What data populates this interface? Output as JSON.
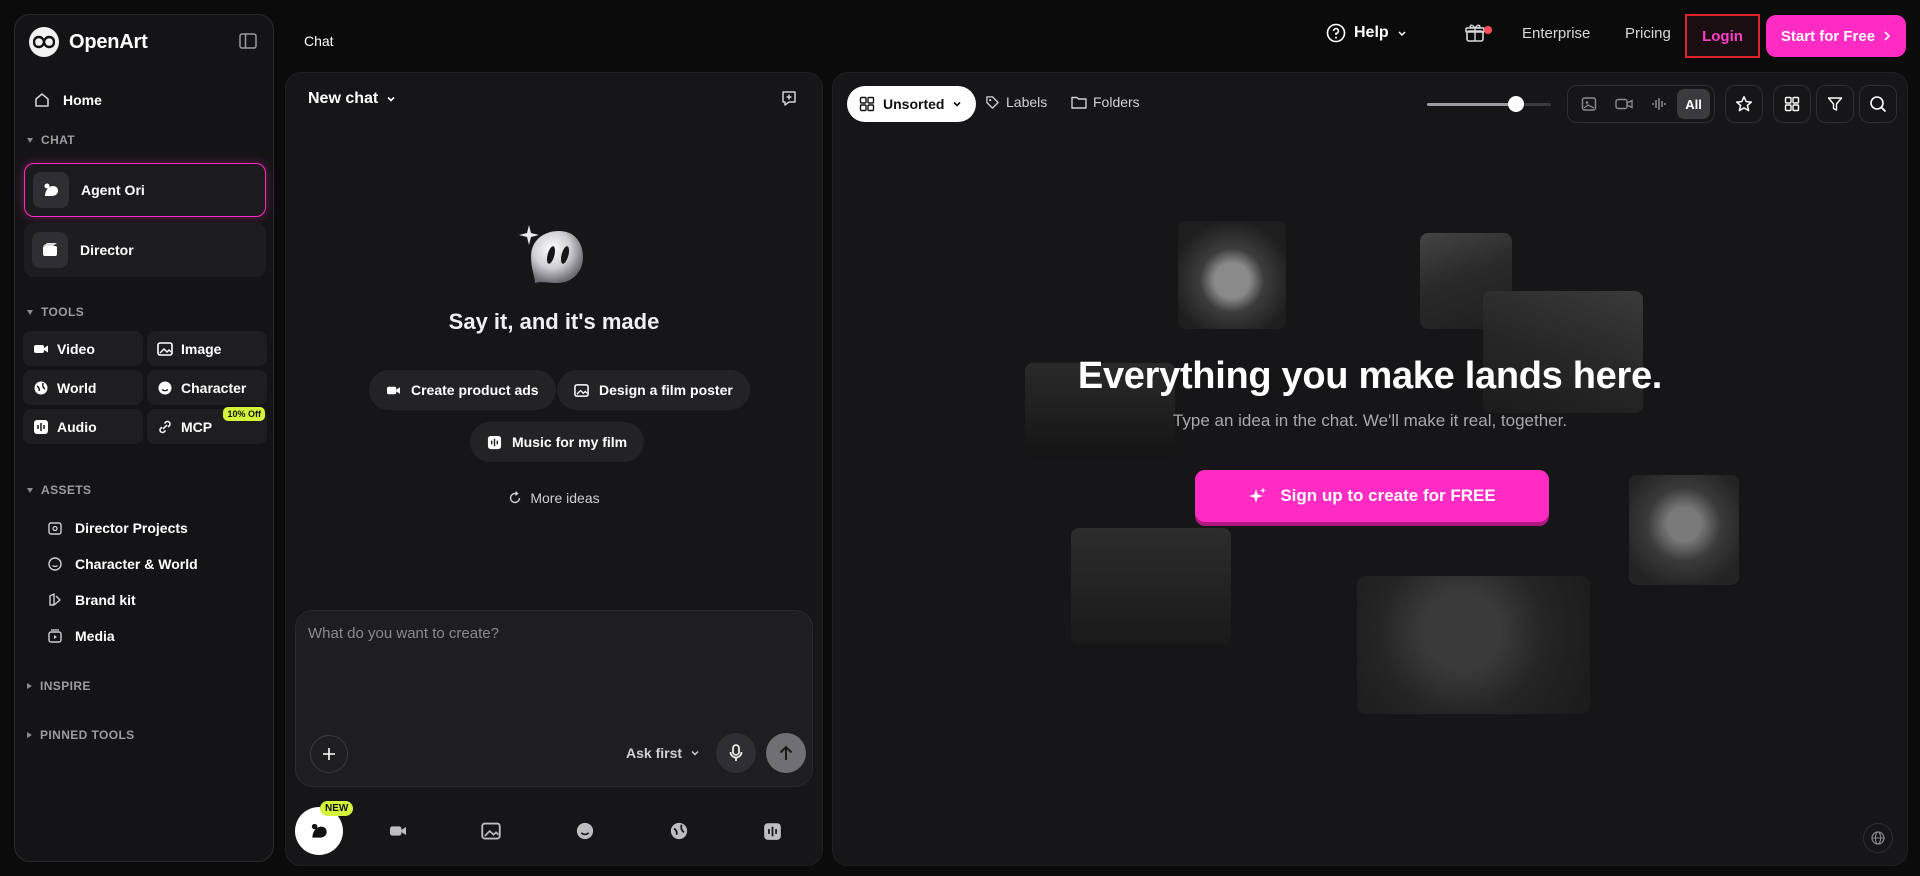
{
  "brand": {
    "name": "OpenArt"
  },
  "sidebar": {
    "home_label": "Home",
    "chat_section": "CHAT",
    "chat_items": [
      {
        "label": "Agent Ori",
        "active": true
      },
      {
        "label": "Director",
        "active": false
      }
    ],
    "tools_section": "TOOLS",
    "tools": [
      {
        "label": "Video",
        "icon": "video-icon"
      },
      {
        "label": "Image",
        "icon": "image-icon"
      },
      {
        "label": "World",
        "icon": "world-icon"
      },
      {
        "label": "Character",
        "icon": "character-icon"
      },
      {
        "label": "Audio",
        "icon": "audio-icon"
      },
      {
        "label": "MCP",
        "icon": "mcp-icon",
        "badge": "10% Off"
      }
    ],
    "assets_section": "ASSETS",
    "assets": [
      {
        "label": "Director Projects",
        "icon": "director-projects-icon"
      },
      {
        "label": "Character & World",
        "icon": "character-world-icon"
      },
      {
        "label": "Brand kit",
        "icon": "brand-kit-icon"
      },
      {
        "label": "Media",
        "icon": "media-icon"
      }
    ],
    "inspire_section": "INSPIRE",
    "pinned_section": "PINNED TOOLS"
  },
  "header": {
    "page_title": "Chat",
    "help": "Help",
    "enterprise": "Enterprise",
    "pricing": "Pricing",
    "login": "Login",
    "start": "Start for Free"
  },
  "chat": {
    "title": "New chat",
    "tagline": "Say it, and it's made",
    "suggestions": [
      "Create product ads",
      "Design a film poster",
      "Music for my film"
    ],
    "more_ideas": "More ideas",
    "input_placeholder": "What do you want to create?",
    "ask_mode": "Ask first",
    "new_badge": "NEW"
  },
  "gallery": {
    "sort_label": "Unsorted",
    "labels_link": "Labels",
    "folders_link": "Folders",
    "filter_all": "All",
    "zoom_level": 0.72,
    "hero_title": "Everything you make lands here.",
    "hero_sub": "Type an idea in the chat. We'll make it real, together.",
    "signup": "Sign up to create for FREE"
  },
  "colors": {
    "accent": "#ff2bc2",
    "badge": "#d4f53c",
    "login_border": "#e0242e",
    "background": "#0b0b0c",
    "panel": "#161618"
  }
}
